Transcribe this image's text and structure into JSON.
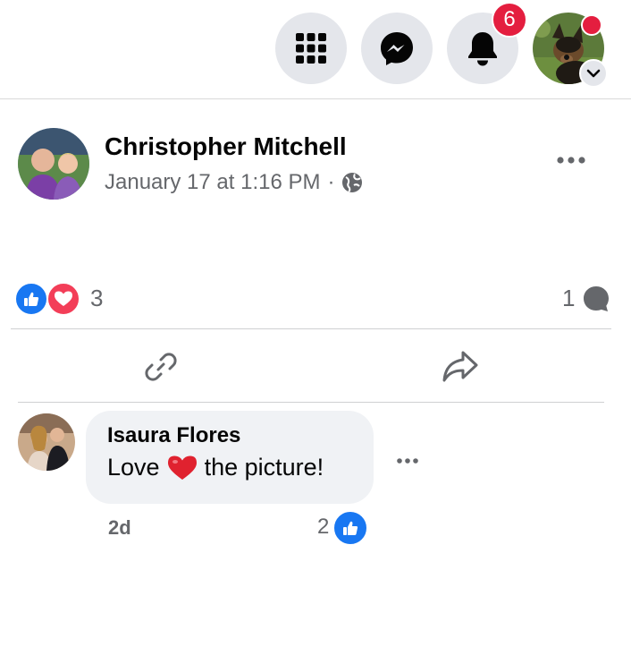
{
  "topbar": {
    "icons": [
      "menu-grid-icon",
      "messenger-icon",
      "bell-icon"
    ],
    "notification_count": "6",
    "profile_icon": "profile-avatar-icon"
  },
  "post": {
    "author": "Christopher Mitchell",
    "timestamp": "January 17 at 1:16 PM",
    "separator": "·",
    "privacy_icon": "globe-icon",
    "more_icon": "more-options-icon",
    "reaction_count": "3",
    "comment_count": "1",
    "actions": [
      "link-icon",
      "share-icon"
    ]
  },
  "comment": {
    "name": "Isaura Flores",
    "text_before": "Love",
    "text_after": "the picture!",
    "time": "2d",
    "like_count": "2"
  },
  "colors": {
    "accent": "#1877f2",
    "badge": "#e41e3f",
    "secondary_text": "#65676b",
    "button_bg": "#e4e6eb",
    "bubble_bg": "#f0f2f5"
  }
}
